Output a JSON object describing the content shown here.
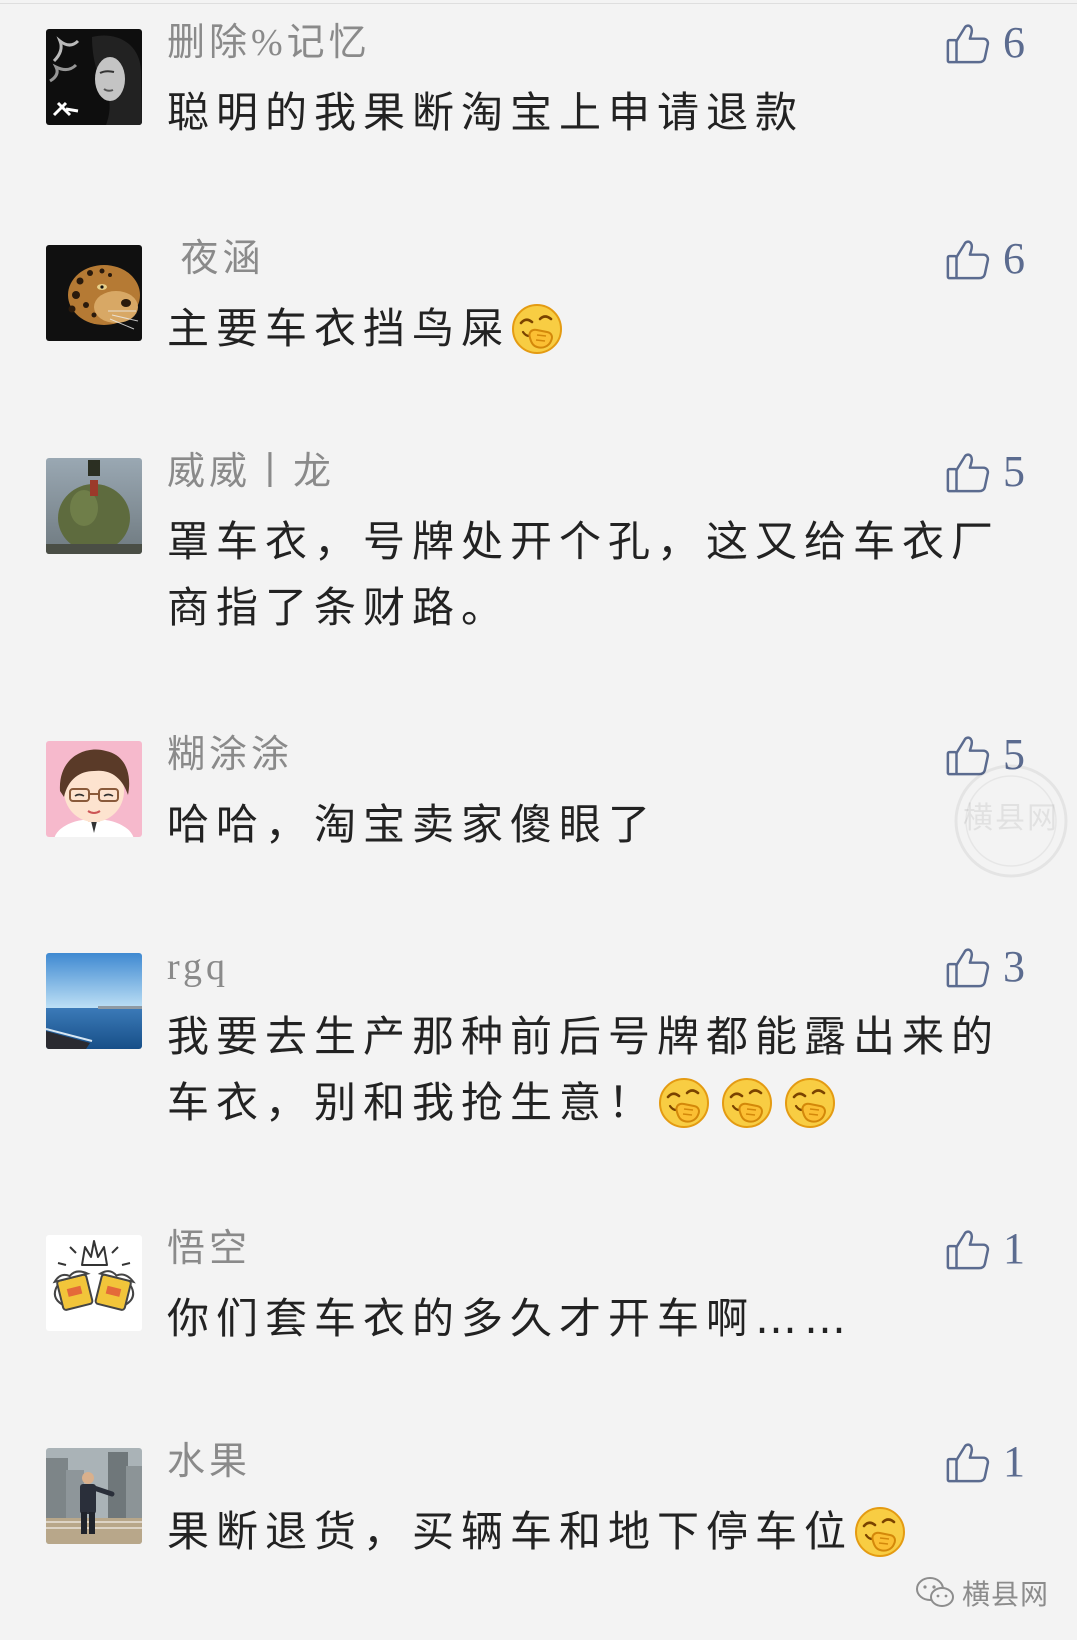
{
  "comments": [
    {
      "user": "删除%记忆",
      "likes": "6",
      "lines": [
        "聪明的我果断淘宝上申请退款"
      ],
      "emoji_counts": [
        0
      ]
    },
    {
      "user": " 夜涵",
      "likes": "6",
      "lines": [
        "主要车衣挡鸟屎"
      ],
      "emoji_counts": [
        1
      ]
    },
    {
      "user": "威威丨龙",
      "likes": "5",
      "lines": [
        "罩车衣，号牌处开个孔，这又给车衣厂",
        "商指了条财路。"
      ],
      "emoji_counts": [
        0,
        0
      ]
    },
    {
      "user": "糊涂涂",
      "likes": "5",
      "lines": [
        "哈哈，淘宝卖家傻眼了"
      ],
      "emoji_counts": [
        0
      ]
    },
    {
      "user": "rgq",
      "likes": "3",
      "lines": [
        "我要去生产那种前后号牌都能露出来的",
        "车衣，别和我抢生意！"
      ],
      "emoji_counts": [
        0,
        3
      ]
    },
    {
      "user": "悟空",
      "likes": "1",
      "lines": [
        "你们套车衣的多久才开车啊……"
      ],
      "emoji_counts": [
        0
      ]
    },
    {
      "user": "水果",
      "likes": "1",
      "lines": [
        "果断退货，买辆车和地下停车位"
      ],
      "emoji_counts": [
        1
      ]
    }
  ],
  "icons": {
    "like": "thumbs-up-icon",
    "emoji": "hand-over-mouth-laugh-emoji",
    "brand": "wechat-icon"
  },
  "colors": {
    "background": "#f3f3f3",
    "username": "#8a8a8a",
    "text": "#222222",
    "like": "#5b6b8f",
    "emoji": "#f8cd43"
  },
  "watermark": {
    "brand": "横县网",
    "stamp": "横县网"
  }
}
